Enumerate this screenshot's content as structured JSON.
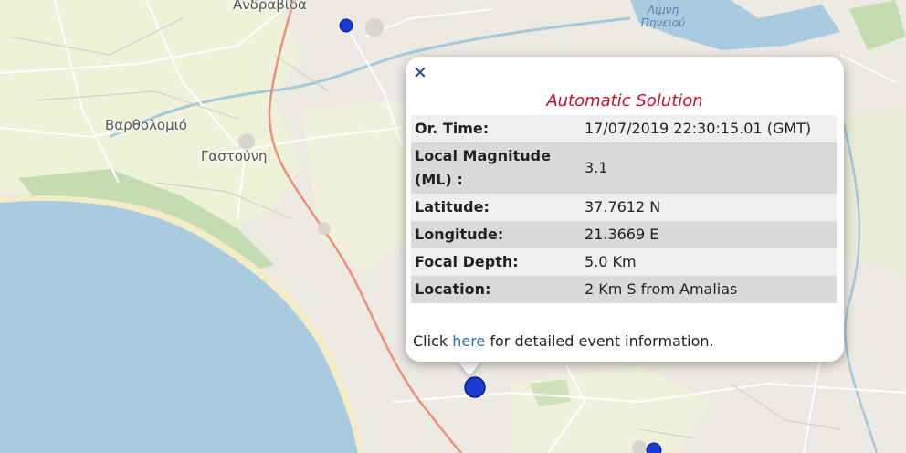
{
  "map": {
    "places": [
      {
        "name": "Ανδραβίδα"
      },
      {
        "name": "Βαρθολομιό"
      },
      {
        "name": "Γαστούνη"
      }
    ],
    "lake_label_line1": "Λίμνη",
    "lake_label_line2": "Πηνειού",
    "colors": {
      "sea": "#a9cbe0",
      "land": "#eceae2",
      "farmland": "#eef2d8",
      "forest": "#c5dcb0",
      "motorway": "#e8927c",
      "river": "#a7c8dc",
      "marker": "#1a3ad8"
    },
    "markers": [
      {
        "name": "event-marker-north"
      },
      {
        "name": "event-marker-selected"
      },
      {
        "name": "event-marker-south"
      }
    ]
  },
  "popup": {
    "close_label": "×",
    "title": "Automatic Solution",
    "rows": [
      {
        "label": "Or. Time:",
        "value": "17/07/2019 22:30:15.01 (GMT)"
      },
      {
        "label": "Local Magnitude (ML) :",
        "value": "3.1"
      },
      {
        "label": "Latitude:",
        "value": "37.7612 N"
      },
      {
        "label": "Longitude:",
        "value": "21.3669 E"
      },
      {
        "label": "Focal Depth:",
        "value": "5.0 Km"
      },
      {
        "label": "Location:",
        "value": "2 Km S from Amalias"
      }
    ],
    "footer_prefix": "Click ",
    "footer_link": "here",
    "footer_suffix": " for detailed event information."
  }
}
